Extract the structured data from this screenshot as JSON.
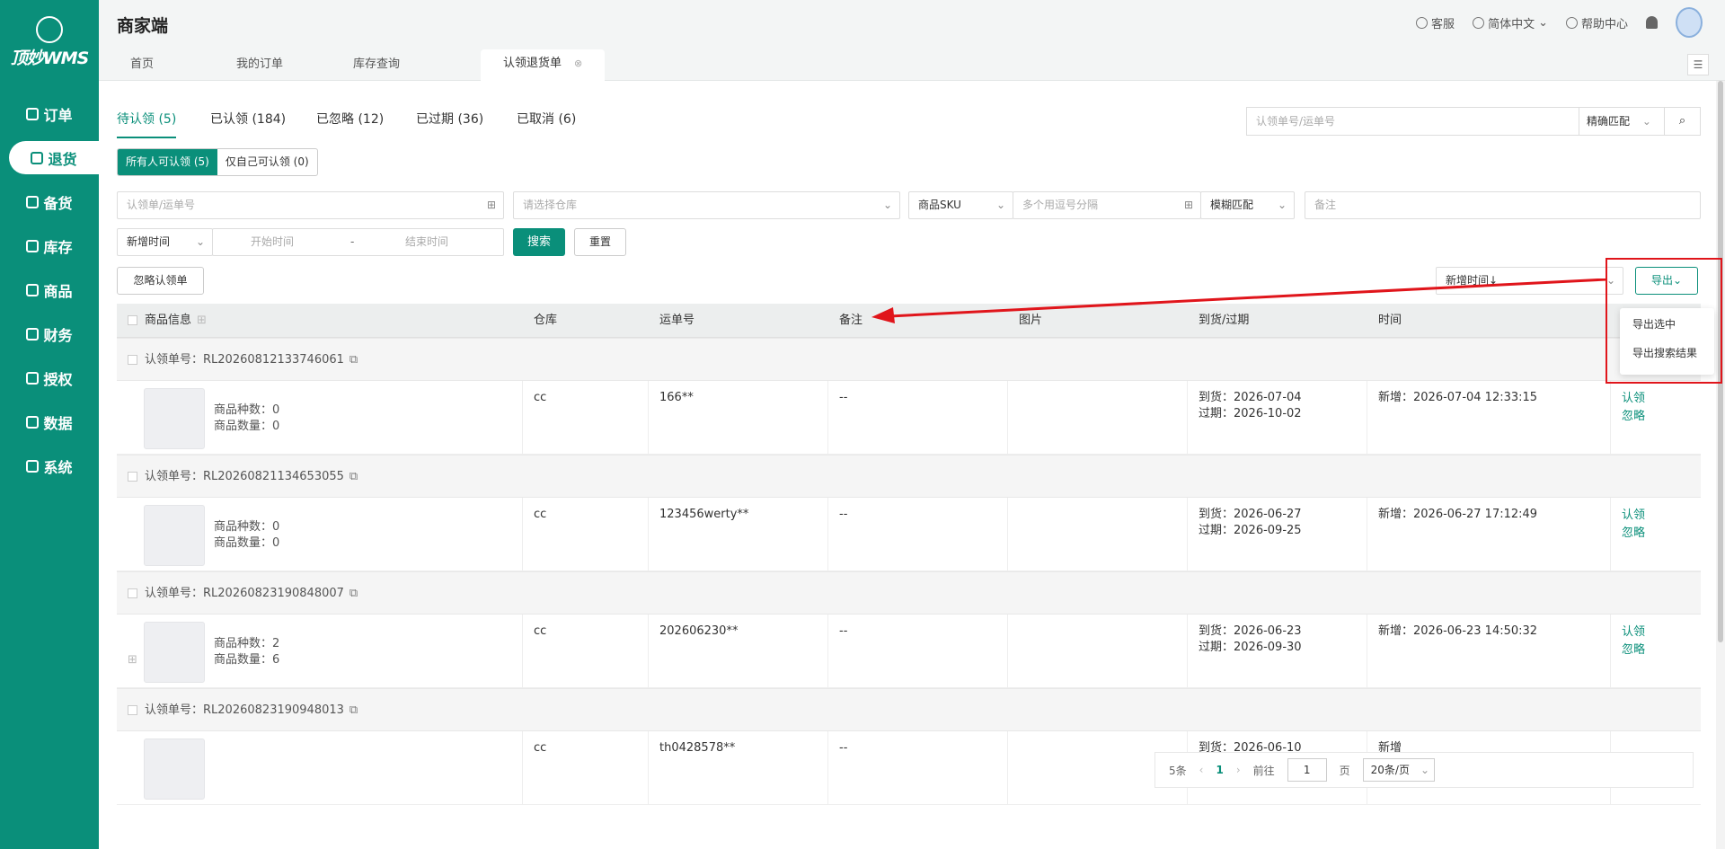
{
  "sidebar": {
    "logo_text": "顶妙WMS",
    "items": [
      {
        "label": "订单",
        "icon": "order-icon"
      },
      {
        "label": "退货",
        "icon": "return-icon",
        "active": true
      },
      {
        "label": "备货",
        "icon": "stock-prep-icon"
      },
      {
        "label": "库存",
        "icon": "inventory-icon"
      },
      {
        "label": "商品",
        "icon": "product-icon"
      },
      {
        "label": "财务",
        "icon": "finance-icon"
      },
      {
        "label": "授权",
        "icon": "auth-icon"
      },
      {
        "label": "数据",
        "icon": "data-icon"
      },
      {
        "label": "系统",
        "icon": "settings-icon"
      }
    ]
  },
  "header": {
    "title": "商家端",
    "service": "客服",
    "language": "简体中文",
    "help": "帮助中心"
  },
  "tabs": [
    {
      "label": "首页"
    },
    {
      "label": "我的订单"
    },
    {
      "label": "库存查询"
    },
    {
      "label": "认领退货单",
      "active": true
    }
  ],
  "status_tabs": [
    {
      "label": "待认领 (5)",
      "active": true
    },
    {
      "label": "已认领 (184)"
    },
    {
      "label": "已忽略 (12)"
    },
    {
      "label": "已过期 (36)"
    },
    {
      "label": "已取消 (6)"
    }
  ],
  "top_search": {
    "placeholder": "认领单号/运单号",
    "match_mode": "精确匹配"
  },
  "claim_scope": {
    "all": "所有人可认领 (5)",
    "self": "仅自己可认领 (0)"
  },
  "filters": {
    "order_placeholder": "认领单/运单号",
    "warehouse_placeholder": "请选择仓库",
    "sku_select": "商品SKU",
    "sku_placeholder": "多个用逗号分隔",
    "fuzzy_select": "模糊匹配",
    "remark_placeholder": "备注",
    "time_type": "新增时间",
    "start_placeholder": "开始时间",
    "range_sep": "-",
    "end_placeholder": "结束时间",
    "search_btn": "搜索",
    "reset_btn": "重置"
  },
  "actions": {
    "ignore_btn": "忽略认领单",
    "sort_select": "新增时间↓",
    "export_btn": "导出",
    "export_menu": [
      "导出选中",
      "导出搜索结果"
    ]
  },
  "colors": {
    "brand": "#0a8f7a",
    "highlight": "#e0151b"
  },
  "table": {
    "headers": [
      "商品信息",
      "仓库",
      "运单号",
      "备注",
      "图片",
      "到货/过期",
      "时间"
    ],
    "groups": [
      {
        "claim_label": "认领单号：",
        "claim_no": "RL20260812133746061",
        "kinds": "商品种数：0",
        "qty": "商品数量：0",
        "warehouse": "cc",
        "waybill": "166**",
        "remark": "--",
        "arrive": "到货：2026-07-04",
        "expire": "过期：2026-10-02",
        "time": "新增：2026-07-04 12:33:15",
        "claim": "认领",
        "ignore": "忽略"
      },
      {
        "claim_label": "认领单号：",
        "claim_no": "RL20260821134653055",
        "kinds": "商品种数：0",
        "qty": "商品数量：0",
        "warehouse": "cc",
        "waybill": "123456werty**",
        "remark": "--",
        "arrive": "到货：2026-06-27",
        "expire": "过期：2026-09-25",
        "time": "新增：2026-06-27 17:12:49",
        "claim": "认领",
        "ignore": "忽略"
      },
      {
        "claim_label": "认领单号：",
        "claim_no": "RL20260823190848007",
        "kinds": "商品种数：2",
        "qty": "商品数量：6",
        "warehouse": "cc",
        "waybill": "202606230**",
        "remark": "--",
        "arrive": "到货：2026-06-23",
        "expire": "过期：2026-09-30",
        "time": "新增：2026-06-23 14:50:32",
        "claim": "认领",
        "ignore": "忽略"
      },
      {
        "claim_label": "认领单号：",
        "claim_no": "RL20260823190948013",
        "warehouse": "cc",
        "waybill": "th0428578**",
        "remark": "--",
        "arrive": "到货：2026-06-10",
        "time": "新增"
      }
    ]
  },
  "pager": {
    "total": "5条",
    "current": "1",
    "goto": "前往",
    "page_input": "1",
    "page_unit": "页",
    "page_size": "20条/页"
  }
}
